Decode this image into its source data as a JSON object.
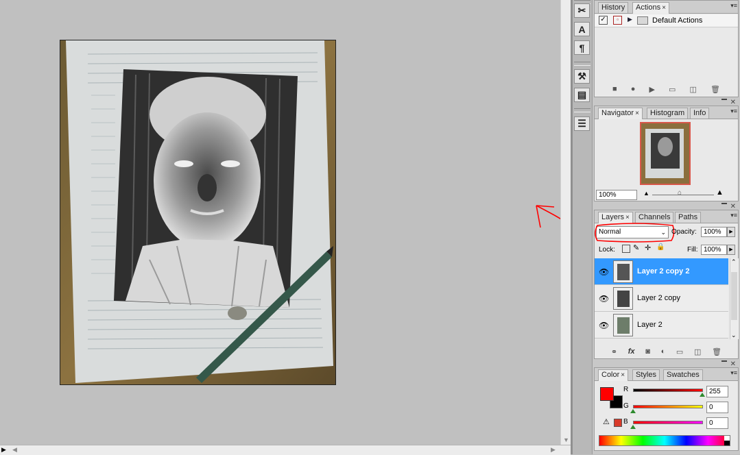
{
  "panels": {
    "history": {
      "tabs": [
        "History",
        "Actions"
      ],
      "action_item": "Default Actions"
    },
    "navigator": {
      "tabs": [
        "Navigator",
        "Histogram",
        "Info"
      ],
      "zoom": "100%"
    },
    "layers": {
      "tabs": [
        "Layers",
        "Channels",
        "Paths"
      ],
      "blend_mode": "Normal",
      "opacity_label": "Opacity:",
      "opacity": "100%",
      "lock_label": "Lock:",
      "fill_label": "Fill:",
      "fill": "100%",
      "items": [
        {
          "name": "Layer 2 copy 2",
          "selected": true
        },
        {
          "name": "Layer 2 copy",
          "selected": false
        },
        {
          "name": "Layer 2",
          "selected": false
        }
      ]
    },
    "color": {
      "tabs": [
        "Color",
        "Styles",
        "Swatches"
      ],
      "r_label": "R",
      "g_label": "G",
      "b_label": "B",
      "r": "255",
      "g": "0",
      "b": "0",
      "foreground": "#ff0000",
      "background": "#000000"
    }
  },
  "icons": {
    "tools": [
      "brush-presets-icon",
      "character-icon",
      "paragraph-icon",
      "tool-presets-icon",
      "layer-comps-icon",
      "notes-icon"
    ],
    "actions_footer": [
      "stop-icon",
      "record-icon",
      "play-icon",
      "new-set-icon",
      "new-action-icon",
      "delete-icon"
    ],
    "layers_footer": [
      "link-icon",
      "fx-icon",
      "mask-icon",
      "adjustment-icon",
      "group-icon",
      "new-layer-icon",
      "trash-icon"
    ]
  },
  "colors": {
    "selection": "#3399ff",
    "annotation": "#ff0000"
  }
}
